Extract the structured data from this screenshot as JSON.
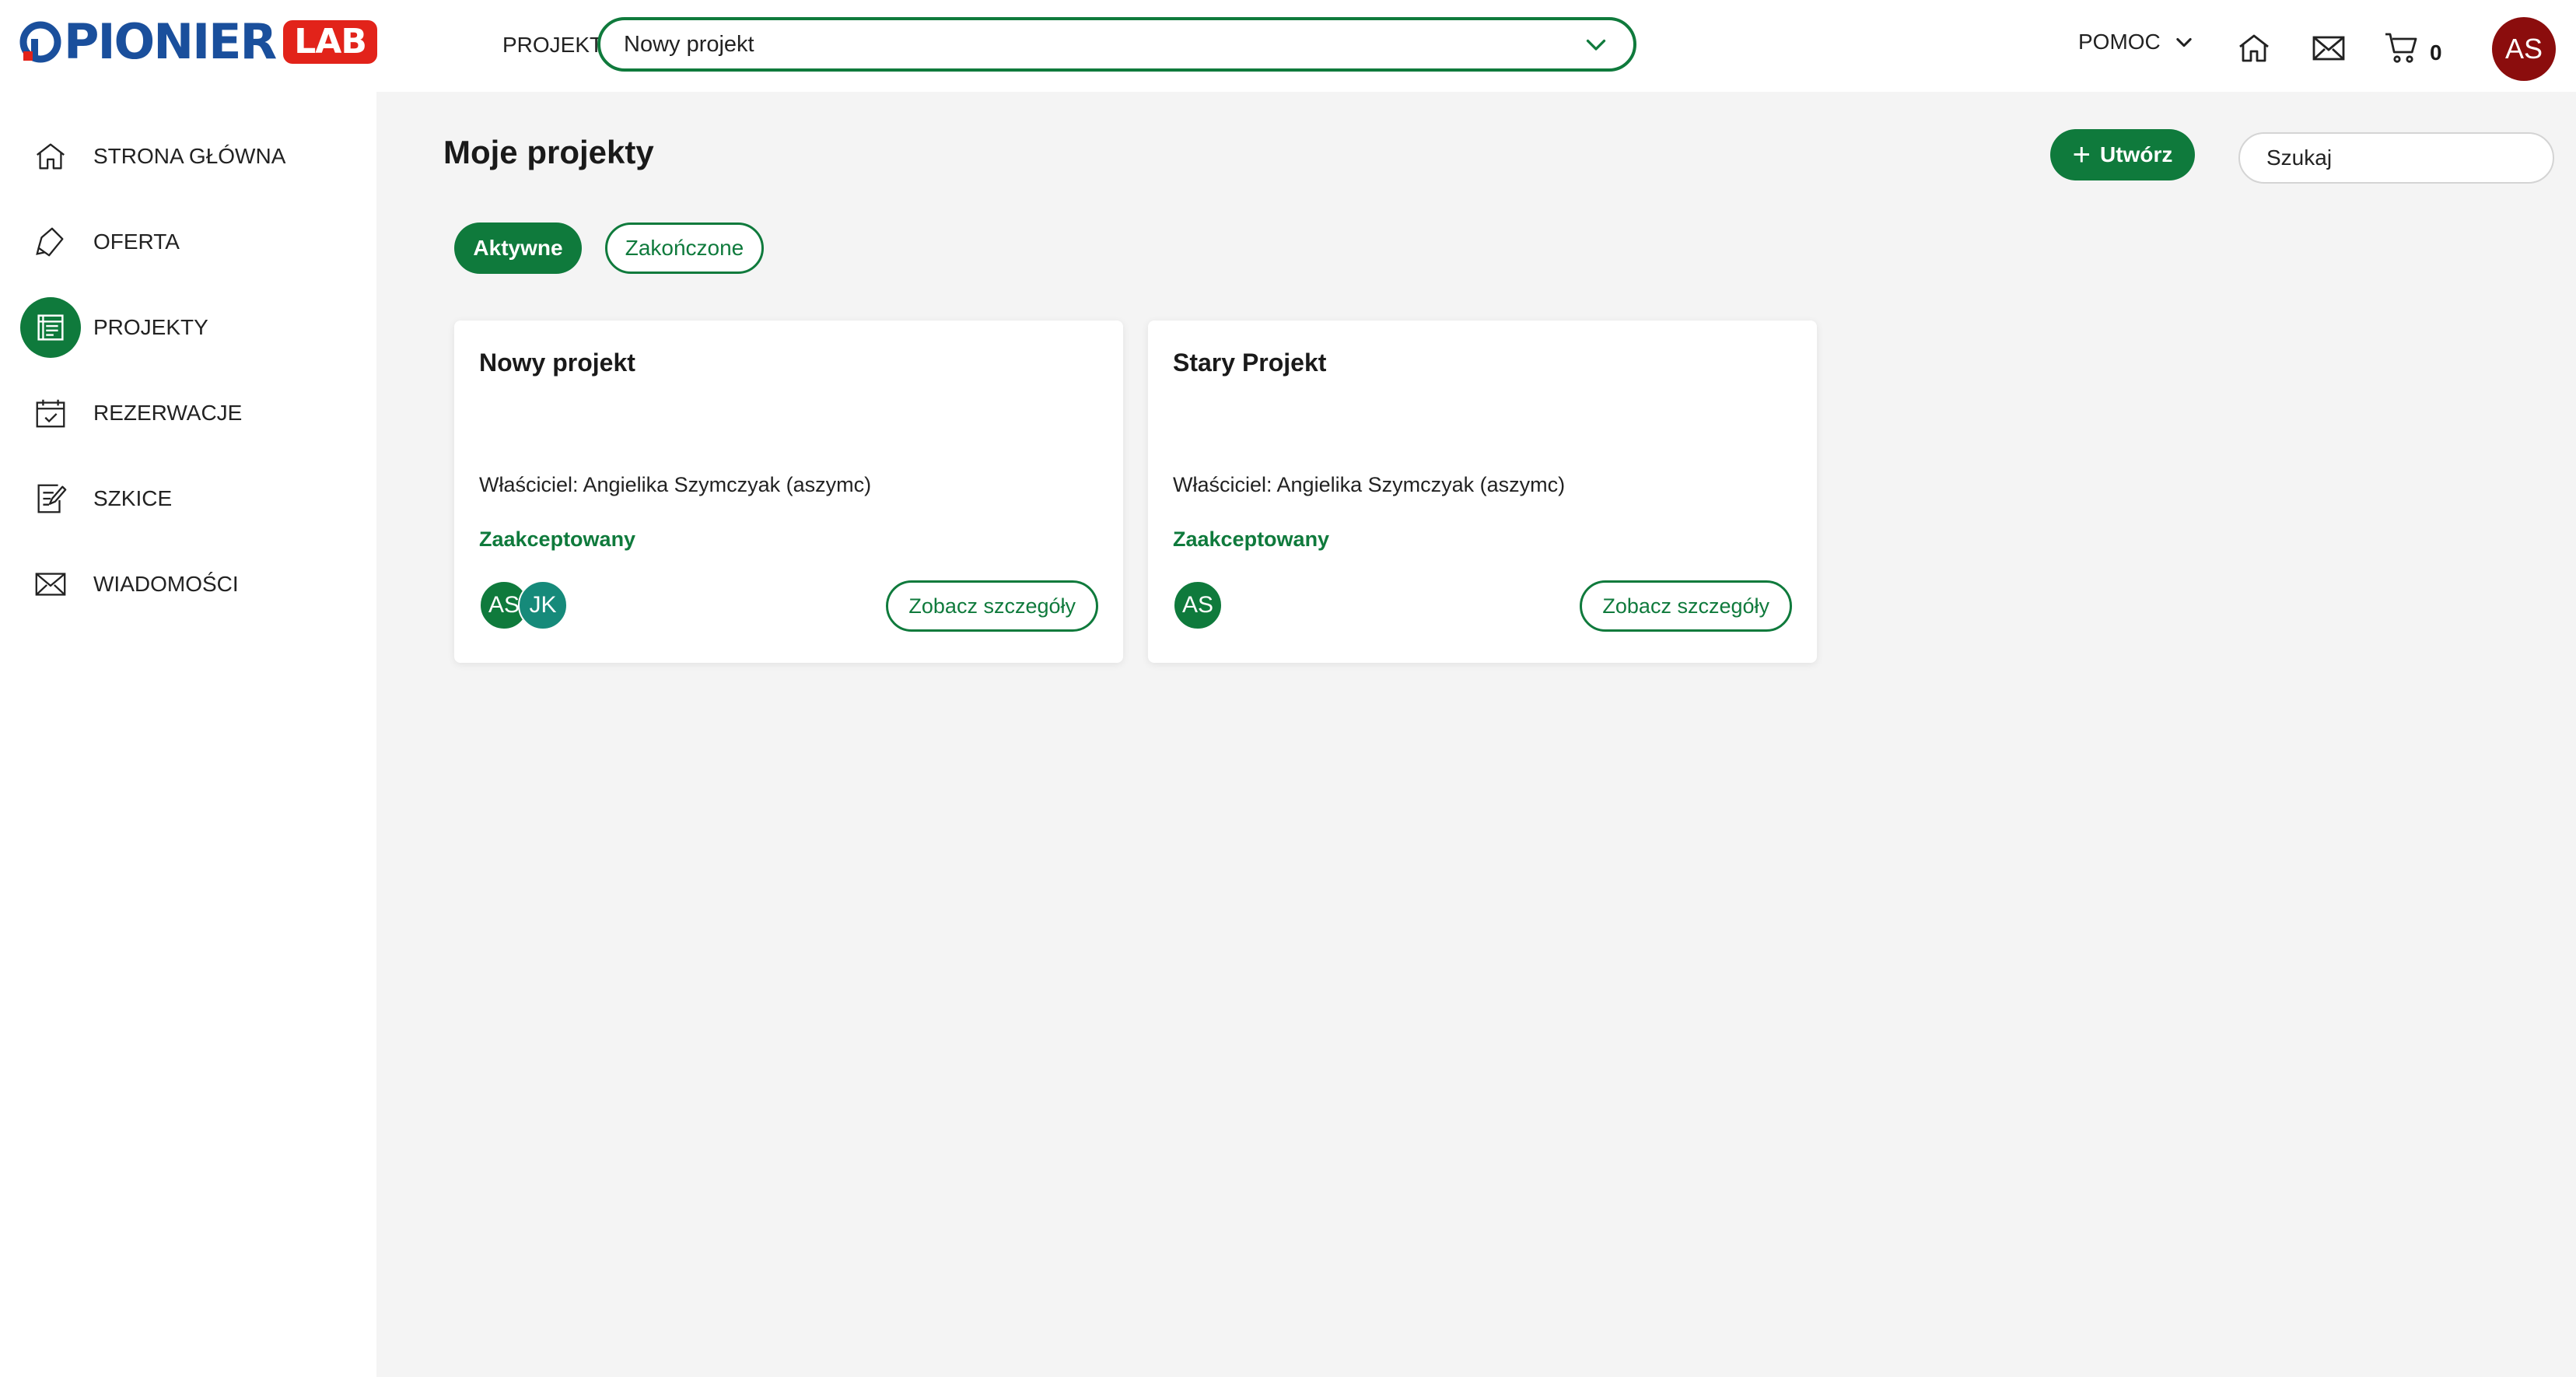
{
  "header": {
    "logo_text": "PIONIER",
    "logo_badge": "LAB",
    "project_label": "PROJEKT",
    "project_select_value": "Nowy projekt",
    "help_label": "POMOC",
    "cart_count": "0",
    "user_initials": "AS"
  },
  "sidebar": {
    "items": [
      {
        "label": "STRONA GŁÓWNA",
        "icon": "home-icon"
      },
      {
        "label": "OFERTA",
        "icon": "tag-icon"
      },
      {
        "label": "PROJEKTY",
        "icon": "projects-icon",
        "active": true
      },
      {
        "label": "REZERWACJE",
        "icon": "calendar-check-icon"
      },
      {
        "label": "SZKICE",
        "icon": "edit-note-icon"
      },
      {
        "label": "WIADOMOŚCI",
        "icon": "mail-icon"
      }
    ]
  },
  "main": {
    "title": "Moje projekty",
    "create_label": "Utwórz",
    "search_placeholder": "Szukaj",
    "filters": [
      {
        "label": "Aktywne",
        "active": true
      },
      {
        "label": "Zakończone",
        "active": false
      }
    ],
    "projects": [
      {
        "title": "Nowy projekt",
        "owner": "Właściciel: Angielika Szymczyak (aszymc)",
        "status": "Zaakceptowany",
        "members": [
          "AS",
          "JK"
        ],
        "details_label": "Zobacz szczegóły"
      },
      {
        "title": "Stary Projekt",
        "owner": "Właściciel: Angielika Szymczyak (aszymc)",
        "status": "Zaakceptowany",
        "members": [
          "AS"
        ],
        "details_label": "Zobacz szczegóły"
      }
    ]
  },
  "colors": {
    "accent": "#0f7a3c",
    "logo_blue": "#1a4f9c",
    "logo_red": "#e2231a",
    "avatar_red": "#8b0d0d",
    "avatar_teal": "#168a7a",
    "background": "#f4f4f4"
  }
}
